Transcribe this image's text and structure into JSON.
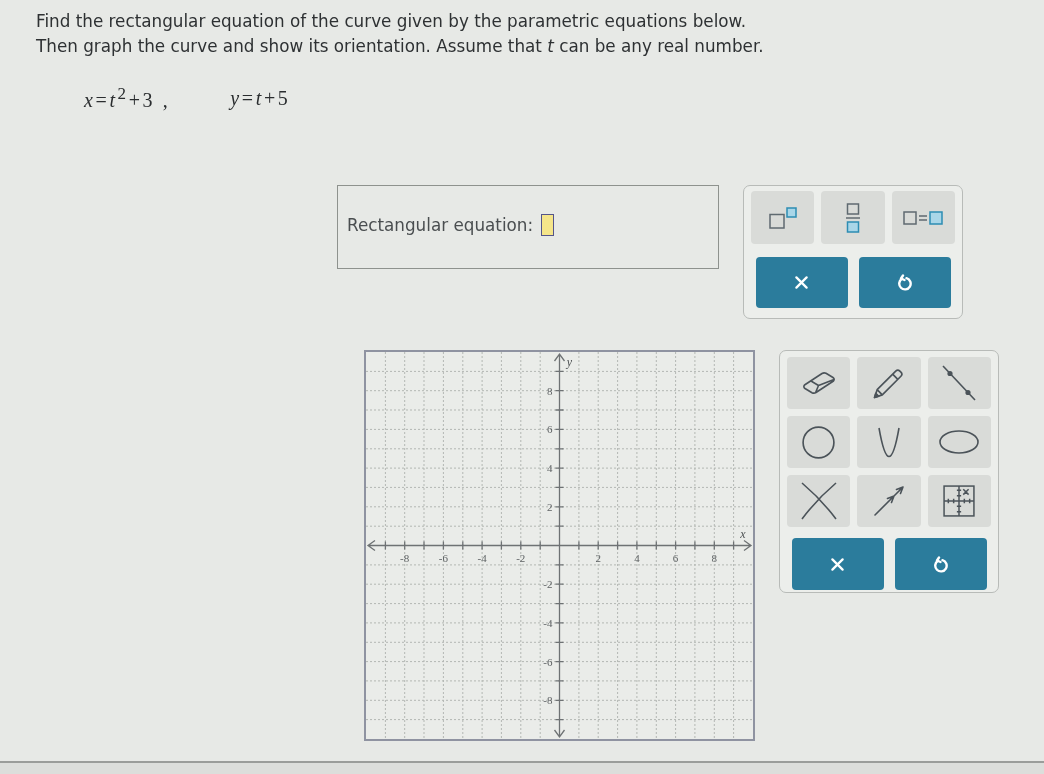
{
  "instructions": [
    "Find the rectangular equation of the curve given by the parametric equations below.",
    "Then graph the curve and show its orientation. Assume that *t* can be any real number."
  ],
  "equations": [
    "*x*=*t*$^{2}$+3 ,",
    "*y*=*t*+5"
  ],
  "answer": {
    "label": "Rectangular equation:",
    "active": true
  },
  "math_palette": {
    "templates": [
      {
        "kind": "superscript"
      },
      {
        "kind": "fraction"
      },
      {
        "kind": "equals"
      }
    ],
    "actions": [
      {
        "kind": "clear"
      },
      {
        "kind": "undo"
      }
    ]
  },
  "graph": {
    "chart_data": {
      "type": "scatter",
      "xlabel": "x",
      "ylabel": "y",
      "xlim": [
        -10,
        10
      ],
      "ylim": [
        -10,
        10
      ],
      "xticks": [
        -8,
        -6,
        -4,
        -2,
        2,
        4,
        6,
        8
      ],
      "yticks": [
        -8,
        -6,
        -4,
        -2,
        2,
        4,
        6,
        8
      ],
      "grid": true
    }
  },
  "tool_palette": {
    "tools": [
      {
        "kind": "eraser"
      },
      {
        "kind": "pencil"
      },
      {
        "kind": "segment"
      },
      {
        "kind": "circle"
      },
      {
        "kind": "parabola"
      },
      {
        "kind": "ellipse"
      },
      {
        "kind": "crossing"
      },
      {
        "kind": "arrow"
      },
      {
        "kind": "grid"
      }
    ],
    "actions": [
      {
        "kind": "clear"
      },
      {
        "kind": "undo"
      }
    ]
  }
}
